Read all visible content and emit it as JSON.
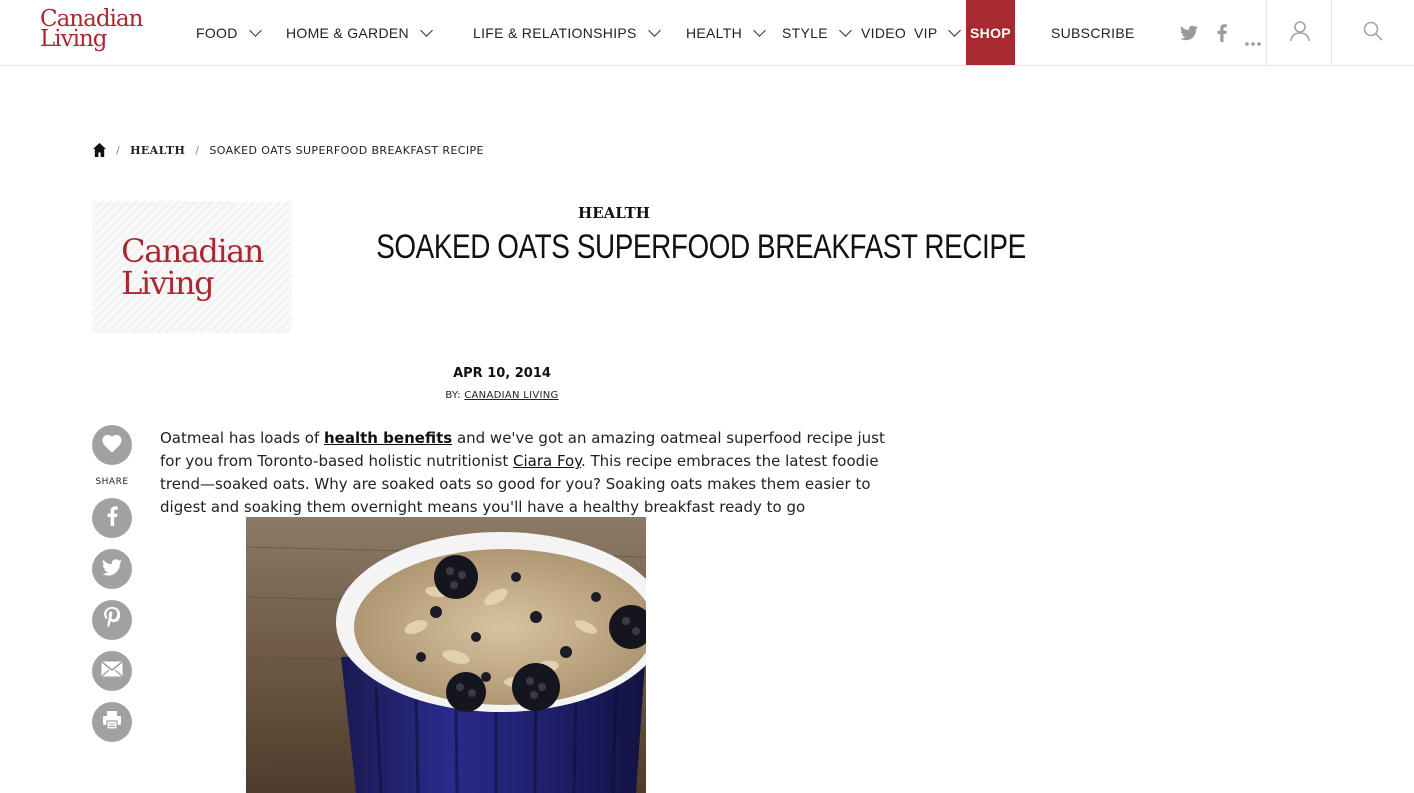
{
  "header": {
    "logo_line1": "Canadian",
    "logo_line2": "Living",
    "nav": [
      {
        "label": "FOOD",
        "has_dropdown": true
      },
      {
        "label": "HOME & GARDEN",
        "has_dropdown": true
      },
      {
        "label": "LIFE & RELATIONSHIPS",
        "has_dropdown": true
      },
      {
        "label": "HEALTH",
        "has_dropdown": true
      },
      {
        "label": "STYLE",
        "has_dropdown": true
      },
      {
        "label": "VIDEO",
        "has_dropdown": false
      },
      {
        "label": "VIP",
        "has_dropdown": true
      },
      {
        "label": "SHOP",
        "has_dropdown": false
      },
      {
        "label": "SUBSCRIBE",
        "has_dropdown": false
      }
    ],
    "social_icons": [
      "twitter-icon",
      "facebook-icon",
      "more-icon"
    ],
    "user_icon": "user-icon",
    "search_icon": "search-icon",
    "shop_color": "#a8292f"
  },
  "breadcrumb": {
    "home_icon": "home-icon",
    "category": "HEALTH",
    "current": "SOAKED OATS SUPERFOOD BREAKFAST RECIPE"
  },
  "article": {
    "thumb_logo_line1": "Canadian",
    "thumb_logo_line2": "Living",
    "category": "HEALTH",
    "title": "SOAKED OATS SUPERFOOD BREAKFAST RECIPE",
    "date": "APR 10, 2014",
    "byline_prefix": "BY:",
    "byline_author": "CANADIAN LIVING",
    "body": {
      "t1": "Oatmeal has loads of ",
      "link1": "health benefits",
      "t2": " and we've got an amazing oatmeal superfood recipe just for you from Toronto-based holistic nutritionist ",
      "link2": "Ciara Foy",
      "t3": ". This recipe embraces the latest foodie trend—soaked oats. Why are soaked oats so good for you? Soaking oats makes them easier to digest and soaking them overnight means you'll have a healthy breakfast ready to go"
    }
  },
  "share": {
    "label": "SHARE",
    "icons": [
      "heart-icon",
      "facebook-icon",
      "twitter-icon",
      "pinterest-icon",
      "email-icon",
      "print-icon"
    ]
  }
}
